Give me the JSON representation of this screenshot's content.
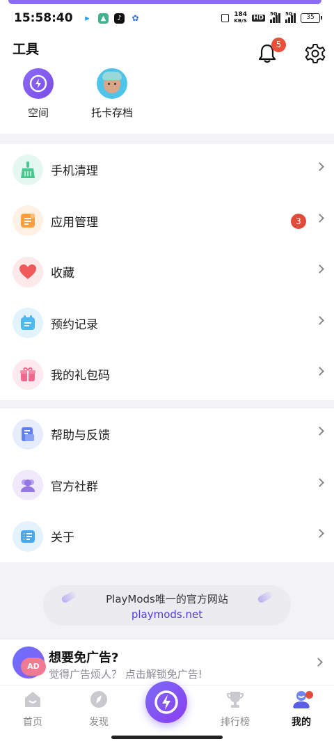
{
  "status_bar": {
    "time": "15:58:40",
    "net_speed": "184",
    "net_unit": "KB/S",
    "hd": "HD",
    "sig1": "5G",
    "sig2": "5G",
    "battery": "35"
  },
  "tools": {
    "title": "工具",
    "notification_count": "5",
    "items": [
      {
        "label": "空间",
        "icon": "space-icon"
      },
      {
        "label": "托卡存档",
        "icon": "toca-avatar-icon"
      }
    ]
  },
  "menu_group_1": [
    {
      "label": "手机清理",
      "icon": "broom-icon",
      "bg": "#e4f8f1",
      "fg": "#46c98f"
    },
    {
      "label": "应用管理",
      "icon": "app-manage-icon",
      "bg": "#fff1e3",
      "fg": "#ff9d3a",
      "badge": "3"
    },
    {
      "label": "收藏",
      "icon": "heart-icon",
      "bg": "#fde9ea",
      "fg": "#f05a5a"
    },
    {
      "label": "预约记录",
      "icon": "calendar-icon",
      "bg": "#e3f3fc",
      "fg": "#4fb8ef"
    },
    {
      "label": "我的礼包码",
      "icon": "gift-icon",
      "bg": "#fde9ee",
      "fg": "#f3698c"
    }
  ],
  "menu_group_2": [
    {
      "label": "帮助与反馈",
      "icon": "help-doc-icon",
      "bg": "#e8edfd",
      "fg": "#5f7ff0"
    },
    {
      "label": "官方社群",
      "icon": "community-icon",
      "bg": "#efe9fb",
      "fg": "#9578e6"
    },
    {
      "label": "关于",
      "icon": "info-list-icon",
      "bg": "#e3f2fc",
      "fg": "#4aa9ee"
    }
  ],
  "website": {
    "line1": "PlayMods唯一的官方网站",
    "url": "playmods.net"
  },
  "ad": {
    "title": "想要免广告?",
    "subtitle": "觉得广告烦人？ 点击解锁免广告!",
    "icon_text": "AD"
  },
  "bottom_nav": [
    {
      "label": "首页",
      "icon": "home-icon"
    },
    {
      "label": "发现",
      "icon": "compass-icon"
    },
    {
      "label": "排行榜",
      "icon": "trophy-icon"
    },
    {
      "label": "我的",
      "icon": "profile-icon",
      "active": true
    }
  ],
  "colors": {
    "accent": "#7b5cf0",
    "badge": "#e04b3a",
    "link": "#4f3ee0"
  }
}
